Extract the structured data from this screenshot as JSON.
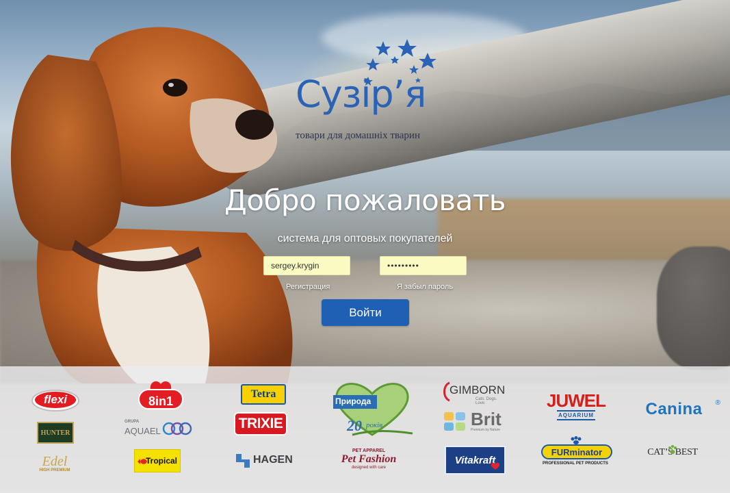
{
  "logo": {
    "name": "Сузір’я",
    "tagline": "товари для домашніх тварин"
  },
  "login": {
    "title": "Добро пожаловать",
    "subtitle": "система для оптовых покупателей",
    "login_value": "sergey.krygin",
    "password_value": "•••••••••",
    "register_label": "Регистрация",
    "forgot_label": "Я забыл пароль",
    "submit_label": "Войти"
  },
  "brands": {
    "flexi": "flexi",
    "eightinone": "8in1",
    "tetra": "Tetra",
    "trixie": "TRIXIE",
    "hunter": "HUNTER",
    "aquael_prefix": "GRUPA",
    "aquael": "AQUAEL",
    "edel": "Edel",
    "edel_sub": "HIGH PREMIUM",
    "tropical": "Tropical",
    "hagen": "HAGEN",
    "pryroda": "Природа",
    "pryroda_years": "20",
    "pryroda_years_word": "років",
    "gimborn": "GIMBORN",
    "gimborn_sub": "Cats. Dogs. Love.",
    "brit": "Brit",
    "brit_sub": "Premium by Nature",
    "juwel": "JUWEL",
    "juwel_sub": "AQUARIUM",
    "canina": "Canina",
    "petfashion_top": "PET APPAREL",
    "petfashion": "Pet Fashion",
    "petfashion_sub": "designed with care",
    "vitakraft": "Vitakraft",
    "furminator": "FURminator",
    "furminator_sub": "PROFESSIONAL PET PRODUCTS",
    "catsbest": "CAT’S BEST"
  },
  "colors": {
    "brand_blue": "#2a63b6",
    "button": "#2060b4",
    "input_bg": "#fafbc3"
  }
}
